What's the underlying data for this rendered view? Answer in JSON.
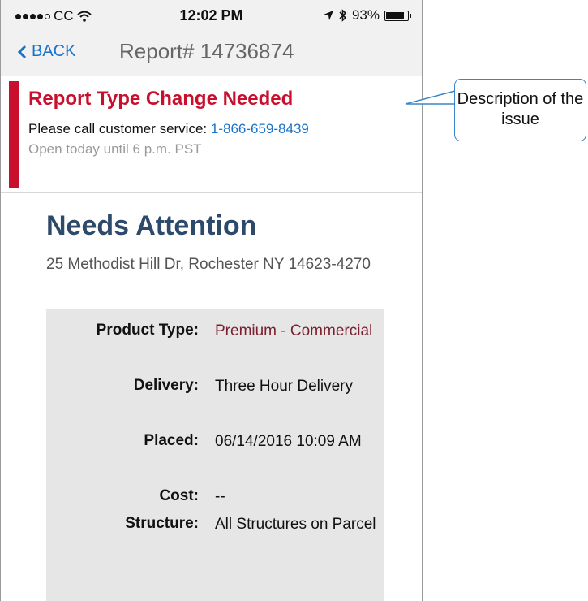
{
  "status_bar": {
    "carrier": "CC",
    "time": "12:02 PM",
    "battery": "93%",
    "battery_level": 0.93
  },
  "nav": {
    "back_label": "BACK",
    "title": "Report# 14736874"
  },
  "alert": {
    "title": "Report Type Change Needed",
    "message_prefix": "Please call customer service: ",
    "phone": "1-866-659-8439",
    "hours": "Open today until 6 p.m. PST"
  },
  "report": {
    "status": "Needs Attention",
    "address": "25 Methodist Hill Dr, Rochester NY 14623-4270",
    "details": [
      {
        "label": "Product Type:",
        "value": "Premium - Commercial"
      },
      {
        "label": "Delivery:",
        "value": "Three Hour Delivery"
      },
      {
        "label": "Placed:",
        "value": "06/14/2016 10:09 AM"
      },
      {
        "label": "Cost:",
        "value": "--"
      },
      {
        "label": "Structure:",
        "value": "All Structures on Parcel"
      }
    ]
  },
  "callout": {
    "text": "Description of the issue"
  },
  "colors": {
    "alert_red": "#c8102e",
    "link_blue": "#1a73c9",
    "heading_navy": "#2d4a6b",
    "product_maroon": "#7a1f2e",
    "callout_border": "#3a85c9"
  }
}
